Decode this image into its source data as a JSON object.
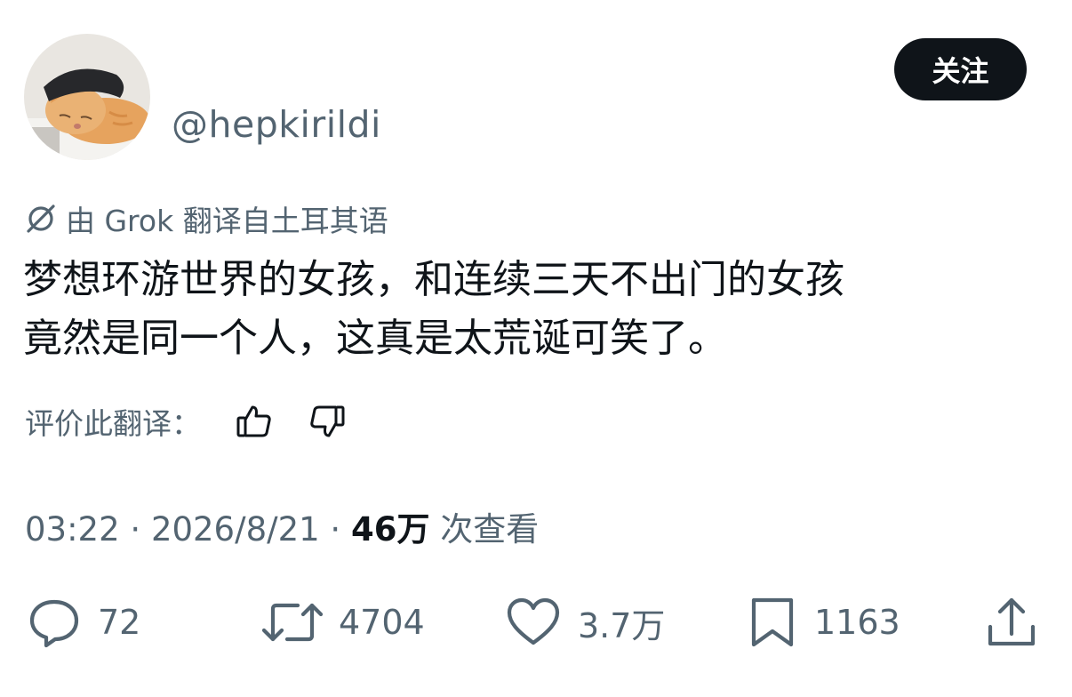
{
  "user": {
    "handle": "@hepkirildi",
    "follow_label": "关注"
  },
  "translation": {
    "notice": "由 Grok 翻译自土耳其语",
    "rate_label": "评价此翻译："
  },
  "tweet": {
    "lines": [
      "梦想环游世界的女孩，和连续三天不出门的女孩",
      "竟然是同一个人，这真是太荒诞可笑了。"
    ]
  },
  "meta": {
    "time": "03:22",
    "sep1": " · ",
    "date": "2026/8/21",
    "sep2": " · ",
    "views_count": "46万",
    "views_label": " 次查看"
  },
  "actions": {
    "replies": "72",
    "retweets": "4704",
    "likes": "3.7万",
    "bookmarks": "1163"
  },
  "icons": {
    "translate": "grok-icon",
    "thumbs_up": "thumbs-up-icon",
    "thumbs_down": "thumbs-down-icon",
    "reply": "reply-icon",
    "retweet": "retweet-icon",
    "like": "heart-icon",
    "bookmark": "bookmark-icon",
    "share": "share-icon"
  }
}
